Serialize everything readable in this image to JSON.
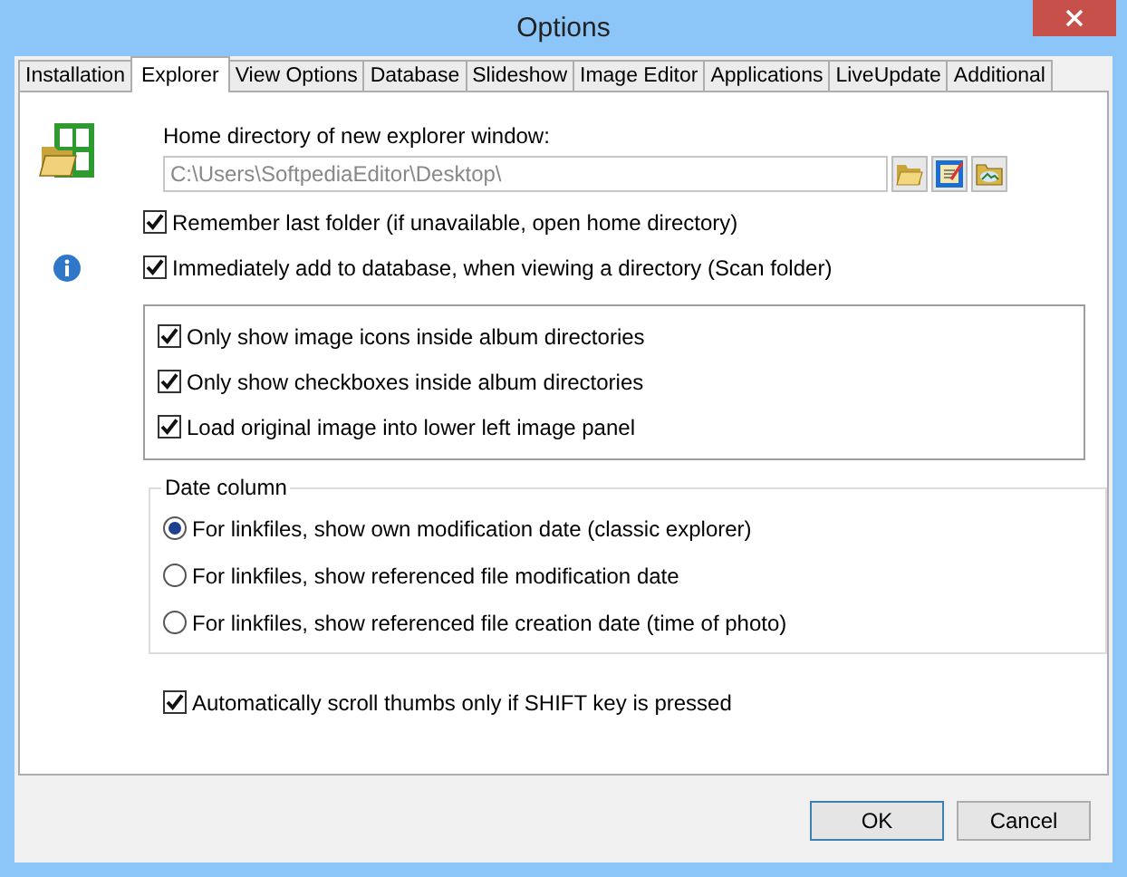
{
  "window": {
    "title": "Options"
  },
  "tabs": [
    {
      "label": "Installation",
      "selected": false
    },
    {
      "label": "Explorer",
      "selected": true
    },
    {
      "label": "View Options",
      "selected": false
    },
    {
      "label": "Database",
      "selected": false
    },
    {
      "label": "Slideshow",
      "selected": false
    },
    {
      "label": "Image Editor",
      "selected": false
    },
    {
      "label": "Applications",
      "selected": false
    },
    {
      "label": "LiveUpdate",
      "selected": false
    },
    {
      "label": "Additional",
      "selected": false
    }
  ],
  "home_directory": {
    "label": "Home directory of new explorer window:",
    "value": "C:\\Users\\SoftpediaEditor\\Desktop\\",
    "disabled": true
  },
  "options": [
    {
      "label": "Remember last folder (if unavailable, open home directory)",
      "checked": true,
      "info": false
    },
    {
      "label": "Immediately add to database, when viewing a directory (Scan folder)",
      "checked": true,
      "info": true
    }
  ],
  "album_group": [
    {
      "label": "Only show image icons inside album directories",
      "checked": true
    },
    {
      "label": "Only show checkboxes inside album directories",
      "checked": true
    },
    {
      "label": "Load original image into lower left image panel",
      "checked": true
    }
  ],
  "date_column": {
    "title": "Date column",
    "choices": [
      {
        "label": "For linkfiles, show own modification date (classic explorer)",
        "selected": true
      },
      {
        "label": "For linkfiles, show referenced file modification date",
        "selected": false
      },
      {
        "label": "For linkfiles, show referenced file creation date (time of photo)",
        "selected": false
      }
    ]
  },
  "scroll_option": {
    "label": "Automatically scroll thumbs only if SHIFT key is pressed",
    "checked": true
  },
  "buttons": [
    {
      "label": "OK",
      "default": true
    },
    {
      "label": "Cancel",
      "default": false
    }
  ]
}
